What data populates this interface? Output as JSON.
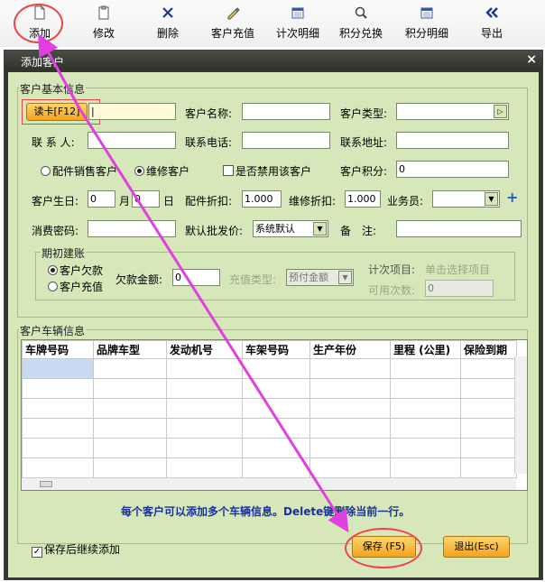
{
  "toolbar": {
    "items": [
      {
        "label": "添加",
        "icon": "document-icon"
      },
      {
        "label": "修改",
        "icon": "edit-icon"
      },
      {
        "label": "删除",
        "icon": "delete-icon"
      },
      {
        "label": "客户充值",
        "icon": "recharge-icon"
      },
      {
        "label": "计次明细",
        "icon": "calendar-icon"
      },
      {
        "label": "积分兑换",
        "icon": "magnifier-icon"
      },
      {
        "label": "积分明细",
        "icon": "calendar-icon"
      },
      {
        "label": "导出",
        "icon": "double-chevron-left-icon"
      }
    ]
  },
  "dialog": {
    "title": "添加客户",
    "close": "×",
    "basic_group": "客户基本信息",
    "read_card": "读卡[F12]",
    "labels": {
      "customer_name": "客户名称:",
      "customer_type": "客户类型:",
      "contact": "联 系 人:",
      "phone": "联系电话:",
      "address": "联系地址:",
      "parts_customer": "配件销售客户",
      "repair_customer": "维修客户",
      "disabled": "是否禁用该客户",
      "points": "客户积分:",
      "birthday": "客户生日:",
      "month": "月",
      "day": "日",
      "parts_discount": "配件折扣:",
      "repair_discount": "维修折扣:",
      "salesman": "业务员:",
      "password": "消费密码:",
      "default_price": "默认批发价:",
      "remark": "备　注:"
    },
    "values": {
      "points": "0",
      "birth_month": "0",
      "birth_day": "0",
      "parts_discount": "1.000",
      "repair_discount": "1.000",
      "default_price": "系统默认"
    },
    "opening": {
      "title": "期初建账",
      "arrears": "客户欠款",
      "recharge": "客户充值",
      "arrears_amount_label": "欠款金额:",
      "arrears_amount": "0",
      "recharge_type_label": "充值类型:",
      "recharge_type": "预付金额",
      "count_item_label": "计次项目:",
      "count_item_placeholder": "单击选择项目",
      "available_count_label": "可用次数:",
      "available_count": "0"
    },
    "vehicle_group": "客户车辆信息",
    "columns": [
      "车牌号码",
      "品牌车型",
      "发动机号",
      "车架号码",
      "生产年份",
      "里程 (公里)",
      "保险到期"
    ],
    "hint": "每个客户可以添加多个车辆信息。Delete键删除当前一行。",
    "save_continue": "保存后继续添加",
    "save": "保存 (F5)",
    "exit": "退出(Esc)"
  },
  "colors": {
    "accent_annotation": "#e040e0",
    "circle": "#e44444",
    "hint": "#1a2fa0"
  }
}
